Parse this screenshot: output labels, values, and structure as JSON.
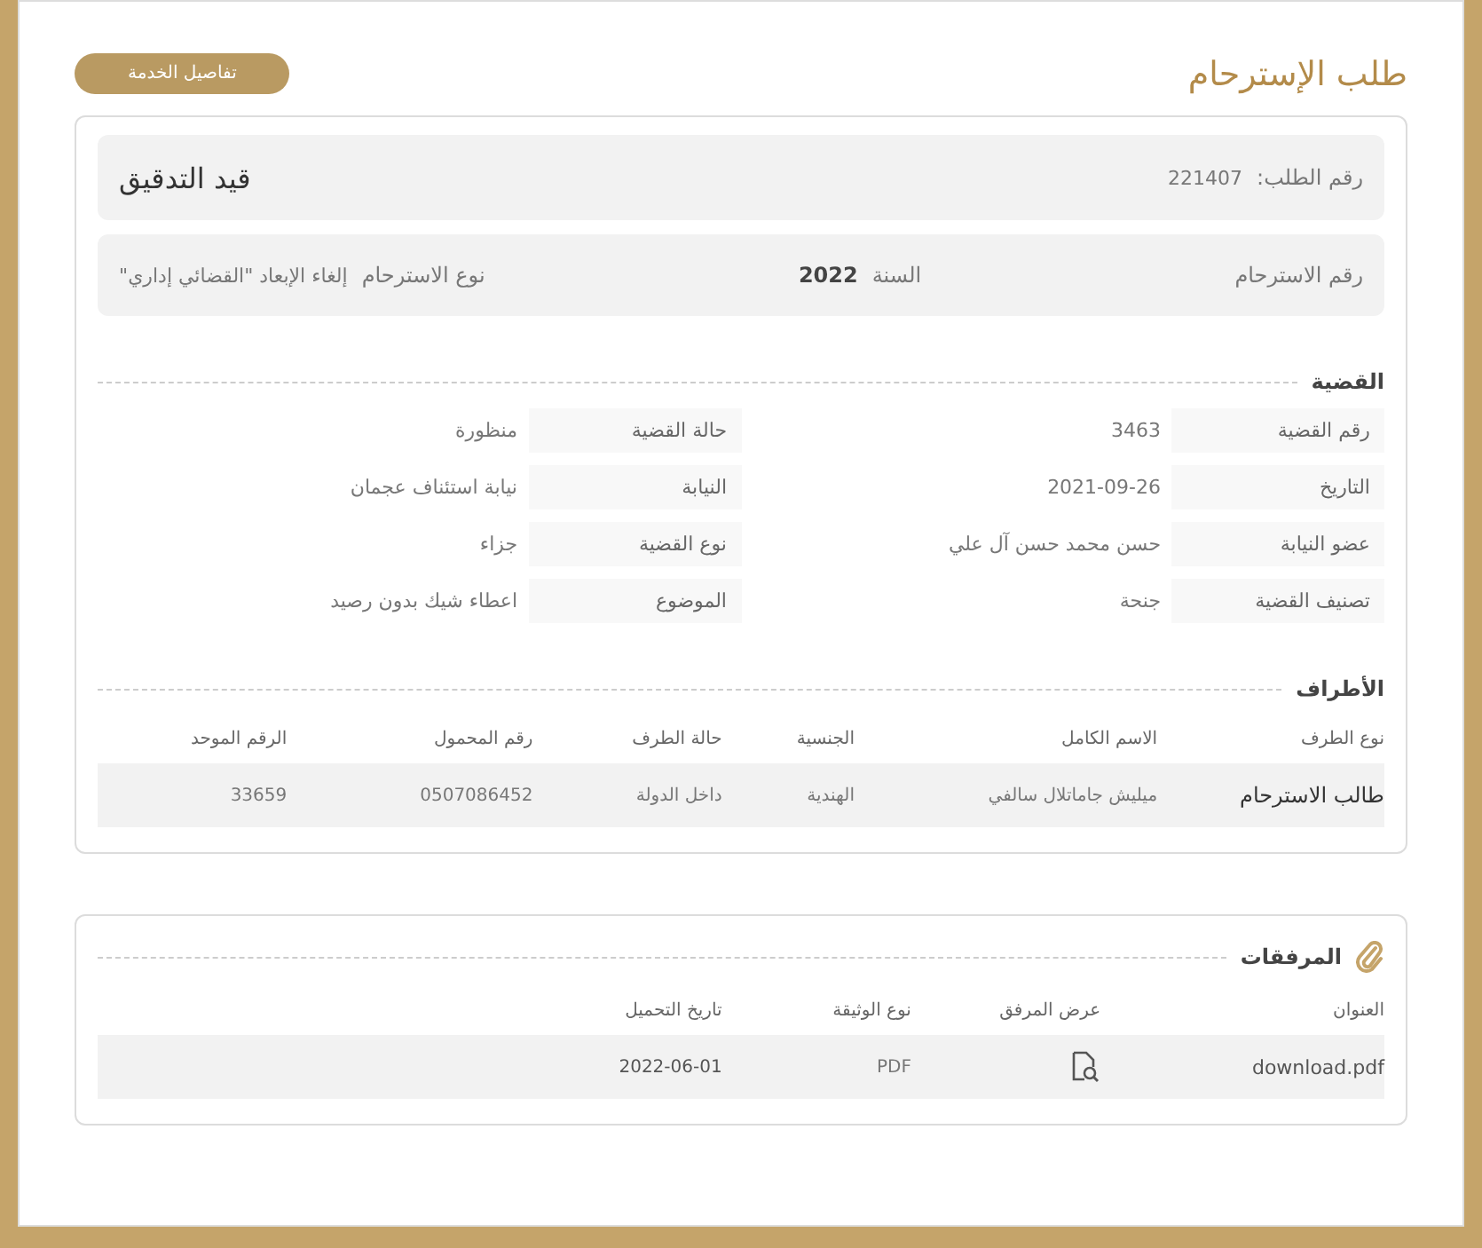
{
  "page_title": "طلب الإسترحام",
  "service_button": "تفاصيل الخدمة",
  "request": {
    "number_label": "رقم الطلب:",
    "number": "221407",
    "status": "قيد التدقيق"
  },
  "summary": [
    {
      "label": "رقم الاسترحام"
    },
    {
      "label": "السنة",
      "value": "2022"
    },
    {
      "label": "نوع الاسترحام",
      "value": "إلغاء الإبعاد \"القضائي إداري\""
    }
  ],
  "case": {
    "title": "القضية",
    "fields": [
      {
        "label": "رقم القضية",
        "value": "3463"
      },
      {
        "label": "حالة القضية",
        "value": "منظورة"
      },
      {
        "label": "التاريخ",
        "value": "2021-09-26"
      },
      {
        "label": "النيابة",
        "value": "نيابة استئناف عجمان"
      },
      {
        "label": "عضو النيابة",
        "value": "حسن محمد حسن آل علي"
      },
      {
        "label": "نوع القضية",
        "value": "جزاء"
      },
      {
        "label": "تصنيف القضية",
        "value": "جنحة"
      },
      {
        "label": "الموضوع",
        "value": "اعطاء شيك بدون رصيد"
      }
    ]
  },
  "parties": {
    "title": "الأطراف",
    "columns": [
      "نوع الطرف",
      "الاسم الكامل",
      "الجنسية",
      "حالة الطرف",
      "رقم المحمول",
      "الرقم الموحد"
    ],
    "rows": [
      [
        "طالب الاسترحام",
        "ميليش جاماتلال سالفي",
        "الهندية",
        "داخل الدولة",
        "0507086452",
        "33659"
      ]
    ]
  },
  "attachments": {
    "title": "المرفقات",
    "columns": [
      "العنوان",
      "عرض المرفق",
      "نوع الوثيقة",
      "تاريخ التحميل"
    ],
    "rows": [
      {
        "title": "download.pdf",
        "type": "PDF",
        "date": "2022-06-01"
      }
    ]
  }
}
